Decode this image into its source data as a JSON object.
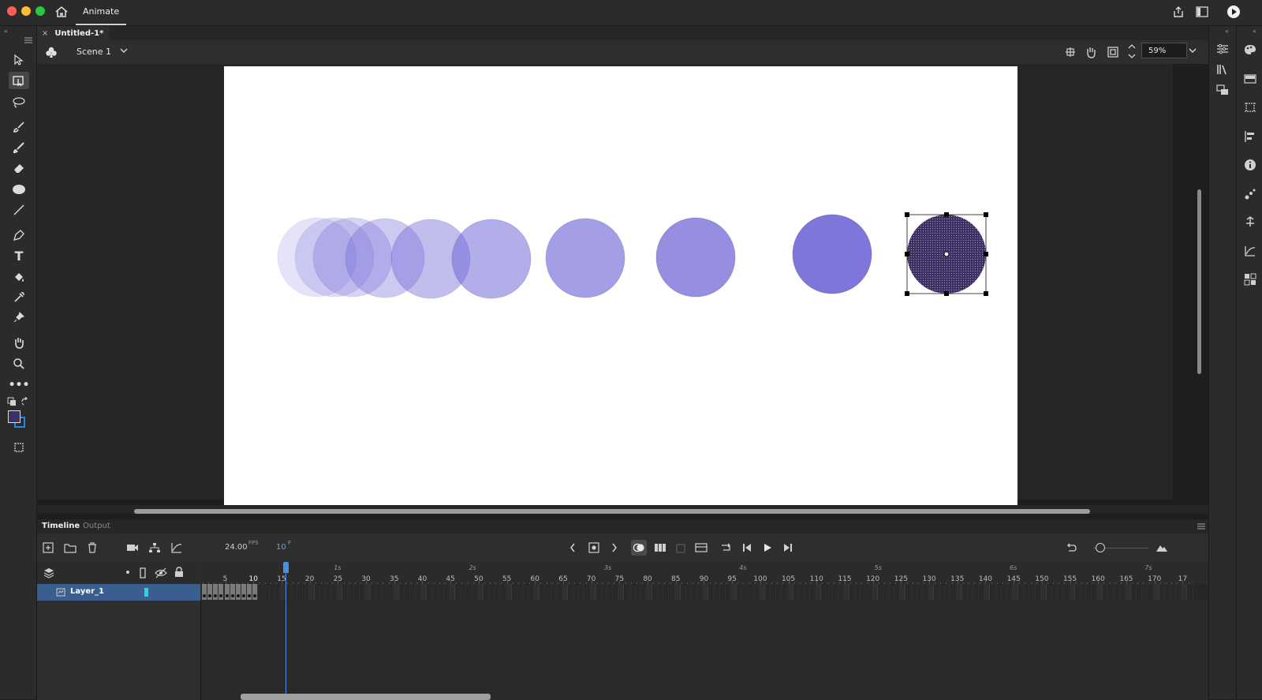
{
  "app": {
    "name": "Animate",
    "brand_color": "#2b2b2b"
  },
  "document": {
    "tab_title": "Untitled-1*",
    "scene": "Scene 1",
    "zoom": "59%"
  },
  "timeline": {
    "tabs": [
      "Timeline",
      "Output"
    ],
    "fps": "24.00",
    "fps_unit": "FPS",
    "current_frame": "10",
    "frame_unit": "F",
    "seconds": [
      "1s",
      "2s",
      "3s",
      "4s",
      "5s",
      "6s",
      "7s"
    ],
    "frame_numbers": [
      "5",
      "10",
      "15",
      "20",
      "25",
      "30",
      "35",
      "40",
      "45",
      "50",
      "55",
      "60",
      "65",
      "70",
      "75",
      "80",
      "85",
      "90",
      "95",
      "100",
      "105",
      "110",
      "115",
      "120",
      "125",
      "130",
      "135",
      "140",
      "145",
      "150",
      "155",
      "160",
      "165",
      "170",
      "17"
    ],
    "layers": [
      {
        "name": "Layer_1",
        "color": "#1fd8f0"
      }
    ]
  },
  "stage": {
    "onion_skin": [
      {
        "opacity": 0.18
      },
      {
        "opacity": 0.22
      },
      {
        "opacity": 0.28
      },
      {
        "opacity": 0.34
      },
      {
        "opacity": 0.42
      },
      {
        "opacity": 0.52
      },
      {
        "opacity": 0.62
      },
      {
        "opacity": 0.72
      },
      {
        "opacity": 0.88
      }
    ],
    "circle_color": "#6c63d6",
    "selected_color": "#3e2f63"
  },
  "icons": {
    "tools": [
      "selection-icon",
      "free-transform-icon",
      "lasso-icon",
      "paint-brush-icon",
      "brush-icon",
      "eraser-icon",
      "oval-icon",
      "line-icon",
      "pen-icon",
      "text-icon",
      "paint-bucket-icon",
      "eyedropper-icon",
      "pin-icon",
      "hand-icon",
      "zoom-icon",
      "more-tools-icon"
    ]
  },
  "colors": {
    "fill": "#3e2f63",
    "stroke": "#1f8ad8"
  }
}
